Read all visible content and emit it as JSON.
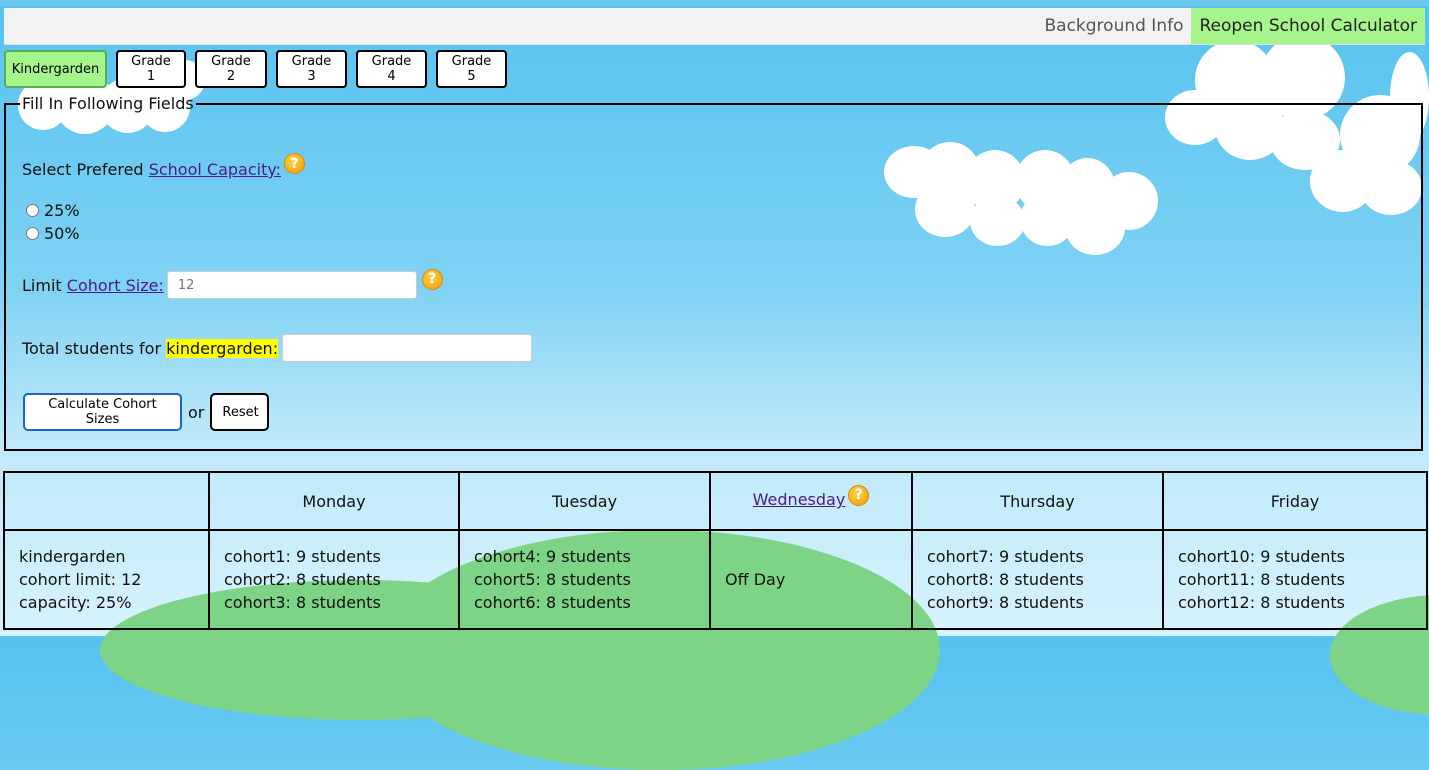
{
  "nav": {
    "background_info": "Background Info",
    "calculator": "Reopen School Calculator"
  },
  "grades": [
    "Kindergarden",
    "Grade 1",
    "Grade 2",
    "Grade 3",
    "Grade 4",
    "Grade 5"
  ],
  "form": {
    "legend": "Fill In Following Fields",
    "capacity_prefix": "Select Prefered",
    "capacity_link": "School Capacity:",
    "capacity_options": [
      "25%",
      "50%"
    ],
    "cohort_prefix": "Limit",
    "cohort_link": "Cohort Size:",
    "cohort_placeholder": "12",
    "total_prefix": "Total students for",
    "total_grade": "kindergarden:",
    "total_value": "",
    "calculate_label": "Calculate Cohort Sizes",
    "or_text": "or",
    "reset_label": "Reset",
    "help_glyph": "?"
  },
  "schedule": {
    "headers": [
      "",
      "Monday",
      "Tuesday",
      "Wednesday",
      "Thursday",
      "Friday"
    ],
    "summary": [
      "kindergarden",
      "cohort limit: 12",
      "capacity: 25%"
    ],
    "monday": [
      "cohort1: 9 students",
      "cohort2: 8 students",
      "cohort3: 8 students"
    ],
    "tuesday": [
      "cohort4: 9 students",
      "cohort5: 8 students",
      "cohort6: 8 students"
    ],
    "wednesday": "Off Day",
    "thursday": [
      "cohort7: 9 students",
      "cohort8: 8 students",
      "cohort9: 8 students"
    ],
    "friday": [
      "cohort10: 9 students",
      "cohort11: 8 students",
      "cohort12: 8 students"
    ]
  },
  "colors": {
    "active_green": "#a6f58c",
    "sky": "#55c2ef",
    "hill": "#7dd487",
    "help_orange": "#f29a00"
  }
}
